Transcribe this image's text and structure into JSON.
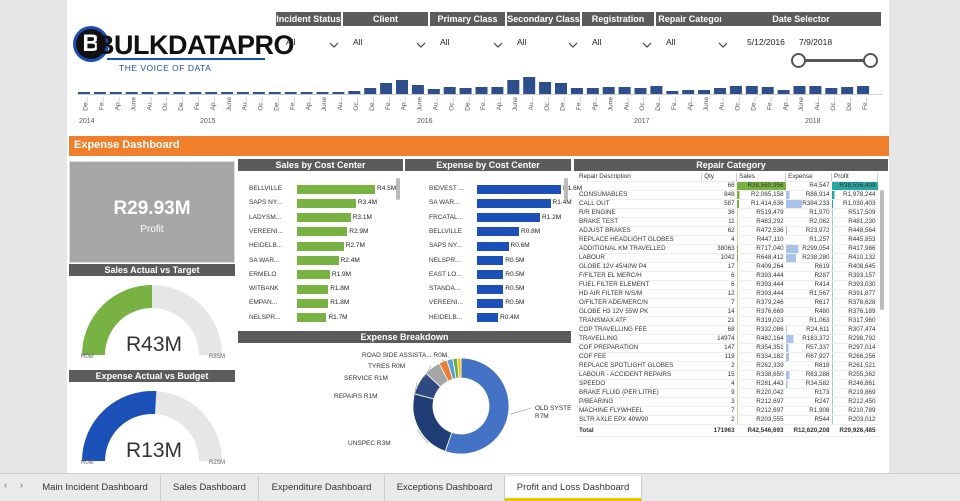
{
  "logo": {
    "brand": "BULKDATAPRO",
    "tagline": "THE VOICE OF DATA"
  },
  "slicers": [
    {
      "label": "Incident Status",
      "value": "All"
    },
    {
      "label": "Client",
      "value": "All"
    },
    {
      "label": "Primary Class",
      "value": "All"
    },
    {
      "label": "Secondary Class",
      "value": "All"
    },
    {
      "label": "Registration",
      "value": "All"
    },
    {
      "label": "Repair Category",
      "value": "All"
    }
  ],
  "date_selector": {
    "label": "Date Selector",
    "start": "5/12/2016",
    "end": "7/9/2018"
  },
  "timeline": {
    "month_labels": [
      "De...",
      "Fe...",
      "Ap...",
      "June",
      "Au...",
      "Oc...",
      "De...",
      "Fe...",
      "Ap...",
      "June",
      "Au...",
      "Oc...",
      "De...",
      "Fe...",
      "Ap...",
      "June",
      "Au...",
      "Oc...",
      "De...",
      "Fe...",
      "Ap...",
      "June",
      "Au...",
      "Oc...",
      "De...",
      "Fe...",
      "Ap...",
      "June",
      "Au...",
      "Oc...",
      "De...",
      "Fe...",
      "Ap...",
      "June",
      "Au...",
      "Oc...",
      "De...",
      "Fe...",
      "Ap...",
      "June",
      "Au...",
      "Oc...",
      "De...",
      "Fe...",
      "Ap...",
      "June",
      "Au...",
      "Oc...",
      "De...",
      "Fe...",
      "Ap...",
      "June",
      "Au...",
      "Oc..."
    ],
    "year_labels": [
      "2014",
      "2015",
      "2016",
      "2017",
      "2018"
    ]
  },
  "header_bar": {
    "title": "Expense Dashboard",
    "color": "#f07f2b"
  },
  "profit_card": {
    "value": "R29.93M",
    "label": "Profit"
  },
  "sales_gauge": {
    "title": "Sales Actual vs Target",
    "value": "R43M",
    "min": "R0M",
    "max": "R85M",
    "fraction": 0.5
  },
  "expense_gauge": {
    "title": "Expense Actual vs Budget",
    "value": "R13M",
    "min": "R0M",
    "max": "R25M",
    "fraction": 0.52
  },
  "sales_by_cc": {
    "title": "Sales by Cost Center",
    "color": "#77b243",
    "items": [
      {
        "label": "BELLVILLE",
        "value": 4.5,
        "text": "R4.5M"
      },
      {
        "label": "SAPS NY...",
        "value": 3.4,
        "text": "R3.4M"
      },
      {
        "label": "LADYSM...",
        "value": 3.1,
        "text": "R3.1M"
      },
      {
        "label": "VEREENI...",
        "value": 2.9,
        "text": "R2.9M"
      },
      {
        "label": "HEIDELB...",
        "value": 2.7,
        "text": "R2.7M"
      },
      {
        "label": "SA WAR...",
        "value": 2.4,
        "text": "R2.4M"
      },
      {
        "label": "ERMELO",
        "value": 1.9,
        "text": "R1.9M"
      },
      {
        "label": "WITBANK",
        "value": 1.8,
        "text": "R1.8M"
      },
      {
        "label": "EMPAN...",
        "value": 1.8,
        "text": "R1.8M"
      },
      {
        "label": "NELSPR...",
        "value": 1.7,
        "text": "R1.7M"
      }
    ]
  },
  "expense_by_cc": {
    "title": "Expense by Cost Center",
    "color": "#1b50b8",
    "items": [
      {
        "label": "BIDVEST ...",
        "value": 1.6,
        "text": "R1.6M"
      },
      {
        "label": "SA WAR...",
        "value": 1.4,
        "text": "R1.4M"
      },
      {
        "label": "FRCATAL...",
        "value": 1.2,
        "text": "R1.2M"
      },
      {
        "label": "BELLVILLE",
        "value": 0.8,
        "text": "R0.8M"
      },
      {
        "label": "SAPS NY...",
        "value": 0.6,
        "text": "R0.6M"
      },
      {
        "label": "NELSPR...",
        "value": 0.5,
        "text": "R0.5M"
      },
      {
        "label": "EAST LO...",
        "value": 0.5,
        "text": "R0.5M"
      },
      {
        "label": "STANDA...",
        "value": 0.5,
        "text": "R0.5M"
      },
      {
        "label": "VEREENI...",
        "value": 0.5,
        "text": "R0.5M"
      },
      {
        "label": "HEIDELB...",
        "value": 0.4,
        "text": "R0.4M"
      }
    ]
  },
  "expense_breakdown": {
    "title": "Expense Breakdown",
    "slices": [
      {
        "label": "OLD SYSTEM UNCATEGORIZED",
        "text": "R7M",
        "value": 7,
        "color": "#4472c4"
      },
      {
        "label": "UNSPEC",
        "text": "R3M",
        "value": 3,
        "color": "#1f3e76"
      },
      {
        "label": "REPAIRS",
        "text": "R1M",
        "value": 1,
        "color": "#2e4a80"
      },
      {
        "label": "SERVICE",
        "text": "R1M",
        "value": 0.7,
        "color": "#a5a5a5"
      },
      {
        "label": "TYRES",
        "text": "R0M",
        "value": 0.35,
        "color": "#ed7d31"
      },
      {
        "label": "ROAD SIDE ASSISTA...",
        "text": "R0M",
        "value": 0.25,
        "color": "#5aa0d8"
      },
      {
        "label": "",
        "text": "",
        "value": 0.2,
        "color": "#70ad47"
      },
      {
        "label": "",
        "text": "",
        "value": 0.15,
        "color": "#ffc000"
      }
    ]
  },
  "repair_category": {
    "title": "Repair Category",
    "columns": [
      "Repair Description",
      "Qty",
      "Sales",
      "Expense",
      "Profit"
    ],
    "rows": [
      [
        "",
        "66",
        "R38,560,956",
        "R4,547",
        "R38,556,409"
      ],
      [
        "CONSUMABLES",
        "848",
        "R2,065,158",
        "R86,914",
        "R1,978,244"
      ],
      [
        "CALL OUT",
        "587",
        "R1,414,636",
        "R384,233",
        "R1,030,403"
      ],
      [
        "R/R ENGINE",
        "36",
        "R519,479",
        "R1,970",
        "R517,509"
      ],
      [
        "BRAKE TEST",
        "11",
        "R483,292",
        "R2,062",
        "R481,230"
      ],
      [
        "ADJUST BRAKES",
        "62",
        "R472,536",
        "R23,972",
        "R448,564"
      ],
      [
        "REPLACE HEADLIGHT GLOBES",
        "4",
        "R447,110",
        "R1,257",
        "R445,853"
      ],
      [
        "ADDITIONAL KM TRAVELLED",
        "38063",
        "R717,040",
        "R299,054",
        "R417,986"
      ],
      [
        "LABOUR",
        "1042",
        "R648,412",
        "R238,280",
        "R410,132"
      ],
      [
        "GLOBE 12V 45/40W P4",
        "17",
        "R409,264",
        "R619",
        "R408,645"
      ],
      [
        "F/FILTER EL MERC/H",
        "6",
        "R393,444",
        "R287",
        "R393,157"
      ],
      [
        "FUEL FILTER ELEMENT",
        "6",
        "R393,444",
        "R414",
        "R393,030"
      ],
      [
        "HD AIR FILTER N/S/M",
        "12",
        "R393,444",
        "R1,567",
        "R391,877"
      ],
      [
        "O/FILTER ADE/MERC/N",
        "7",
        "R379,246",
        "R617",
        "R378,628"
      ],
      [
        "GLOBE H3 12V 55W PK",
        "14",
        "R376,669",
        "R480",
        "R376,189"
      ],
      [
        "TRANSMAX ATF",
        "21",
        "R319,023",
        "R1,063",
        "R317,960"
      ],
      [
        "COP TRAVELLING FEE",
        "68",
        "R332,086",
        "R24,611",
        "R307,474"
      ],
      [
        "TRAVELLING",
        "14974",
        "R482,164",
        "R183,372",
        "R298,792"
      ],
      [
        "COF PREPARATION",
        "147",
        "R354,351",
        "R57,337",
        "R297,014"
      ],
      [
        "COF FEE",
        "119",
        "R334,182",
        "R67,927",
        "R266,256"
      ],
      [
        "REPLACE SPOTLIGHT GLOBES",
        "2",
        "R262,339",
        "R818",
        "R261,521"
      ],
      [
        "LABOUR - ACCIDENT REPAIRS",
        "15",
        "R338,650",
        "R83,288",
        "R255,362"
      ],
      [
        "SPEEDO",
        "4",
        "R281,443",
        "R34,582",
        "R246,861"
      ],
      [
        "BRAKE FLUID (PER LITRE)",
        "9",
        "R220,042",
        "R173",
        "R219,869"
      ],
      [
        "P/BEARING",
        "3",
        "R212,697",
        "R247",
        "R212,450"
      ],
      [
        "MACHINE FLYWHEEL",
        "7",
        "R212,697",
        "R1,908",
        "R210,789"
      ],
      [
        "SLTR AXLE EPX 40W90",
        "2",
        "R203,555",
        "R544",
        "R203,012"
      ]
    ],
    "total": [
      "Total",
      "171963",
      "R42,546,693",
      "R12,620,208",
      "R29,926,485"
    ]
  },
  "tabs": [
    {
      "label": "Main Incident Dashboard",
      "active": false
    },
    {
      "label": "Sales Dashboard",
      "active": false
    },
    {
      "label": "Expenditure Dashboard",
      "active": false
    },
    {
      "label": "Exceptions Dashboard",
      "active": false
    },
    {
      "label": "Profit and Loss Dashboard",
      "active": true
    }
  ],
  "colors": {
    "accent": "#f07f2b",
    "header_grey": "#5b5b5b",
    "sales_green": "#77b243",
    "expense_blue": "#1b50b8",
    "timeline_blue": "#2e4f8c",
    "tab_underline": "#e6c800"
  }
}
